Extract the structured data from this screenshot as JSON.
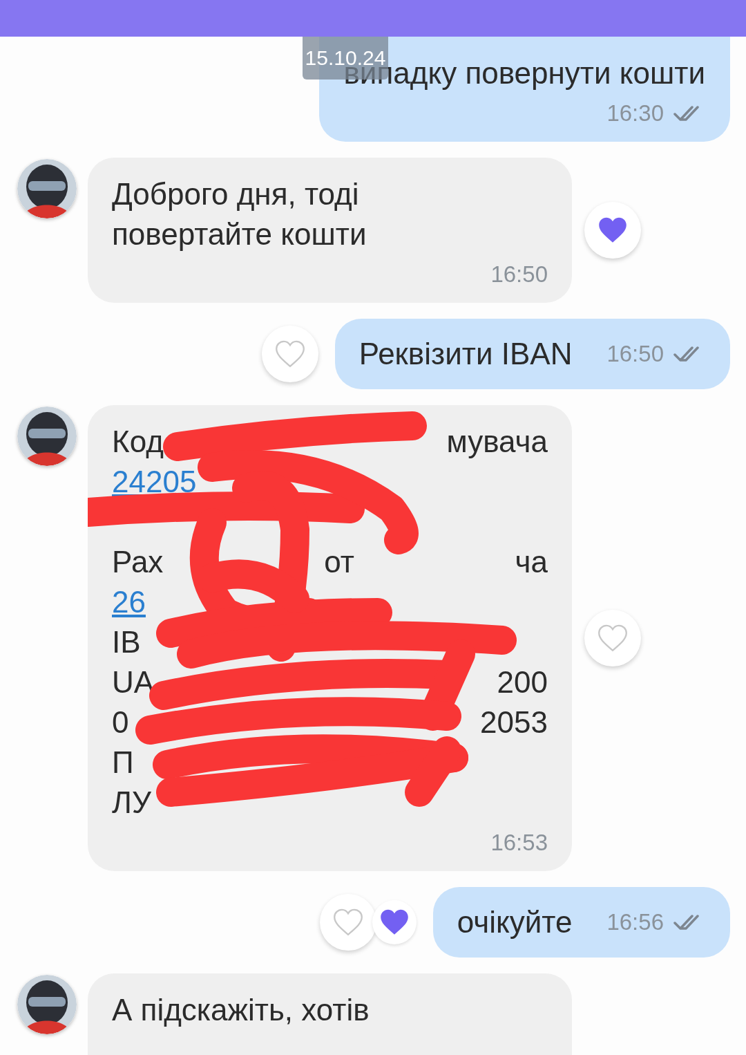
{
  "date_badge": "15.10.24",
  "messages": [
    {
      "kind": "outgoing_cut",
      "lines": [
        "випадку повернути кошти"
      ],
      "time": "16:30",
      "read": true
    },
    {
      "kind": "incoming",
      "text": "Доброго дня, тоді повертайте кошти",
      "time": "16:50",
      "reactions": [
        {
          "liked": true
        }
      ]
    },
    {
      "kind": "outgoing",
      "lines": [
        "Реквізити IBAN"
      ],
      "time": "16:50",
      "read": true,
      "reactions": [
        {
          "liked": false
        }
      ]
    },
    {
      "kind": "redacted",
      "fragment_lines": [
        {
          "kind": "text",
          "parts": [
            "Код",
            "мувача"
          ]
        },
        {
          "kind": "link",
          "parts": [
            "24205"
          ]
        },
        {
          "kind": "covered"
        },
        {
          "kind": "text",
          "parts": [
            "Рах",
            "от",
            "ча"
          ]
        },
        {
          "kind": "link",
          "parts": [
            "26"
          ]
        },
        {
          "kind": "text",
          "parts": [
            "ІВ"
          ]
        },
        {
          "kind": "text",
          "parts": [
            "UA",
            "200"
          ]
        },
        {
          "kind": "text",
          "parts": [
            "0",
            "2053"
          ]
        },
        {
          "kind": "text",
          "parts": [
            "П"
          ]
        },
        {
          "kind": "text",
          "parts": [
            "ЛУ"
          ]
        }
      ],
      "time": "16:53",
      "reactions": [
        {
          "liked": false
        }
      ]
    },
    {
      "kind": "outgoing",
      "lines": [
        "очікуйте"
      ],
      "time": "16:56",
      "read": true,
      "reactions": [
        {
          "liked": false
        },
        {
          "liked": true
        }
      ]
    },
    {
      "kind": "incoming",
      "text": "А підскажіть, хотів"
    }
  ]
}
